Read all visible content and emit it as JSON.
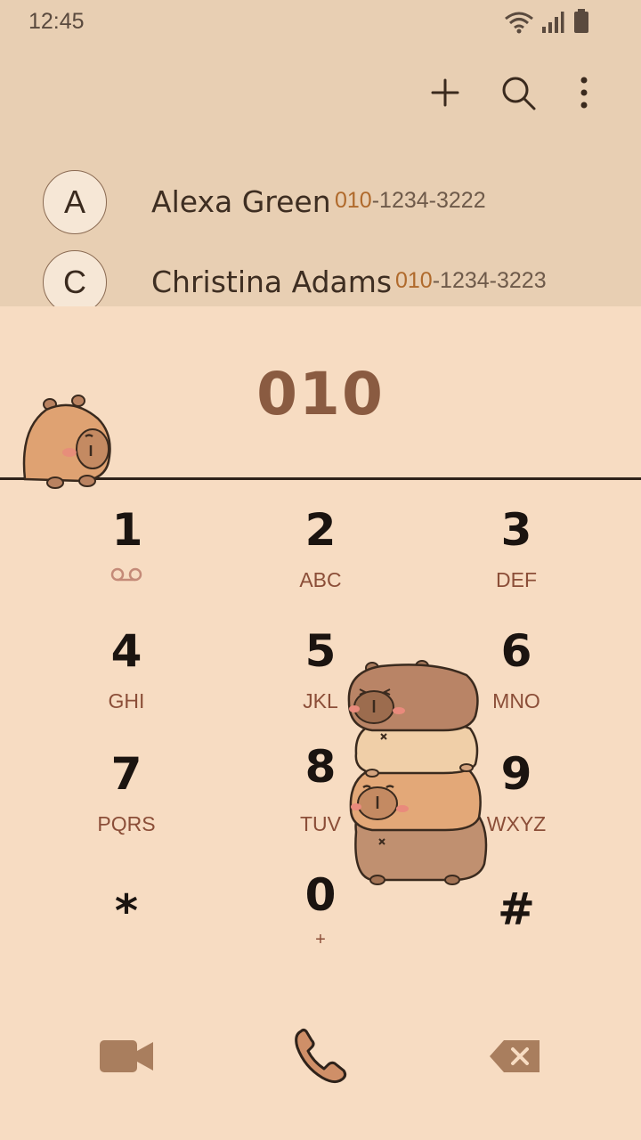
{
  "status_bar": {
    "time": "12:45",
    "icons": [
      "wifi-icon",
      "signal-icon",
      "battery-icon"
    ]
  },
  "actions": {
    "add_icon": "plus-icon",
    "search_icon": "search-icon",
    "more_icon": "more-vertical-icon"
  },
  "contacts": [
    {
      "initial": "A",
      "name": "Alexa Green",
      "number_match": "010",
      "number_rest": "-1234-3222"
    },
    {
      "initial": "C",
      "name": "Christina Adams",
      "number_match": "010",
      "number_rest": "-1234-3223"
    }
  ],
  "dial_input": "010",
  "keypad": [
    {
      "digit": "1",
      "letters": "",
      "icon": "voicemail-icon"
    },
    {
      "digit": "2",
      "letters": "ABC"
    },
    {
      "digit": "3",
      "letters": "DEF"
    },
    {
      "digit": "4",
      "letters": "GHI"
    },
    {
      "digit": "5",
      "letters": "JKL"
    },
    {
      "digit": "6",
      "letters": "MNO"
    },
    {
      "digit": "7",
      "letters": "PQRS"
    },
    {
      "digit": "8",
      "letters": "TUV"
    },
    {
      "digit": "9",
      "letters": "WXYZ"
    },
    {
      "digit": "*",
      "letters": ""
    },
    {
      "digit": "0",
      "letters": "+"
    },
    {
      "digit": "#",
      "letters": ""
    }
  ],
  "bottom_bar": {
    "video_icon": "video-call-icon",
    "call_icon": "phone-call-icon",
    "backspace_icon": "backspace-icon"
  },
  "colors": {
    "background": "#f7dcc2",
    "top_area": "#e8cfb3",
    "digit": "#1b1410",
    "letters": "#8b4e38",
    "number_highlight": "#b06a2c",
    "dial_text": "#8a5b41"
  }
}
